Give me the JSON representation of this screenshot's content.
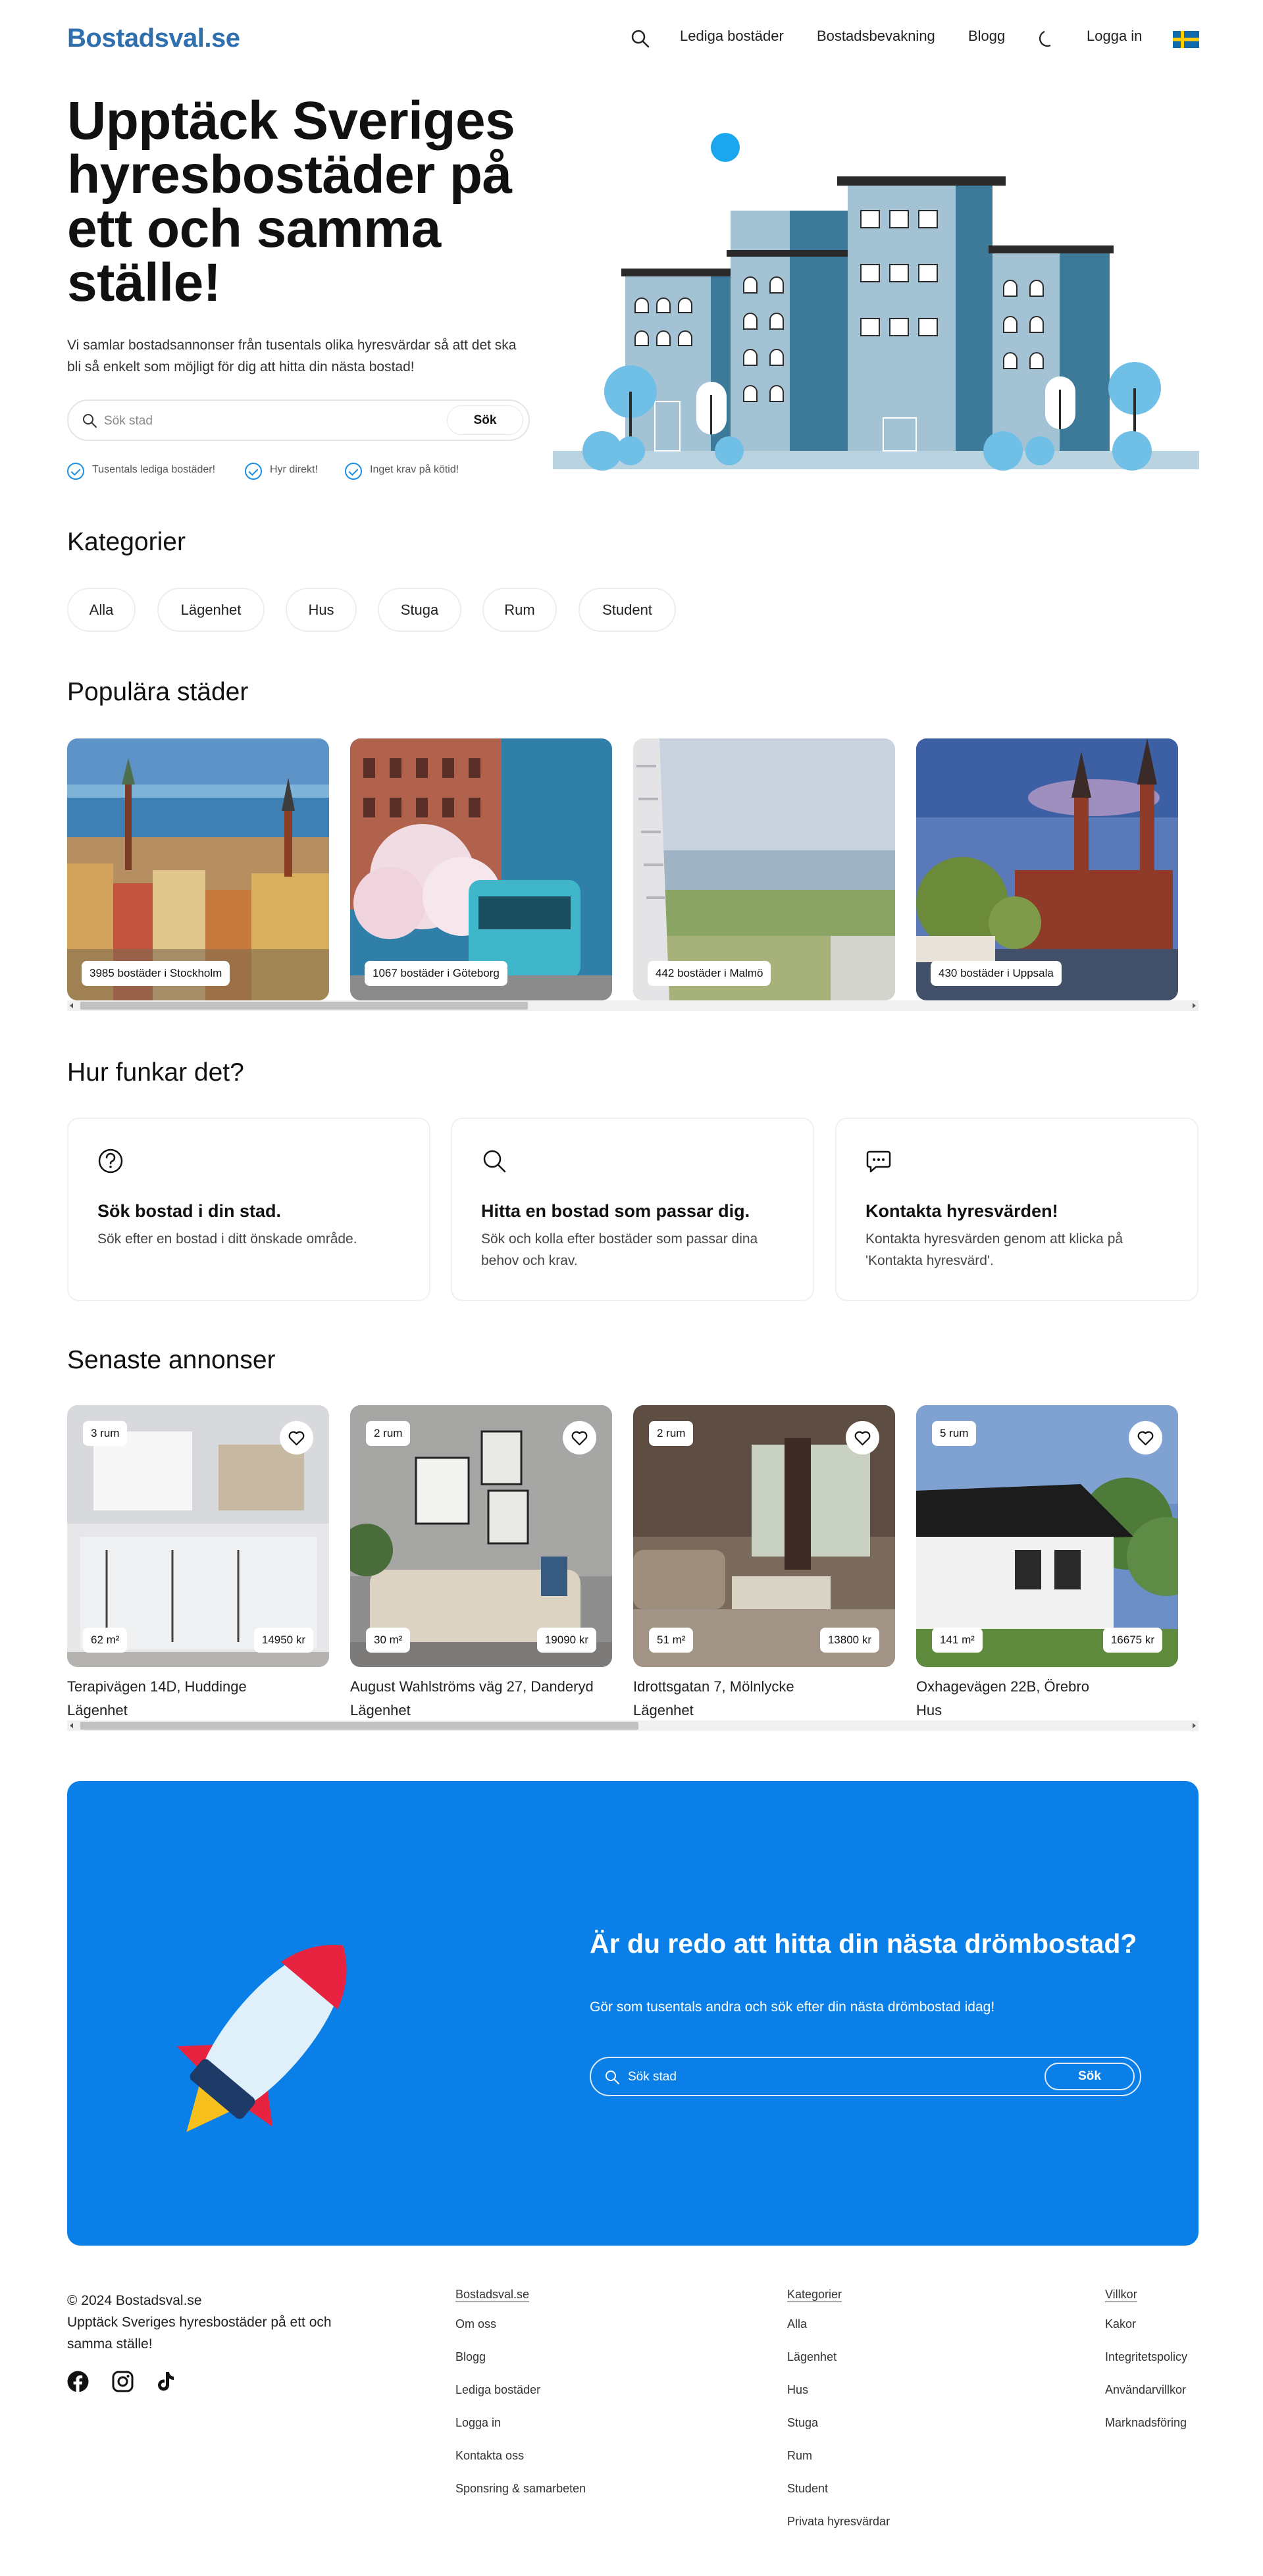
{
  "header": {
    "logo": "Bostadsval.se",
    "nav": [
      "Lediga bostäder",
      "Bostadsbevakning",
      "Blogg",
      "Logga in"
    ],
    "icons": [
      "search-icon",
      "moon-icon",
      "swedish-flag-icon"
    ]
  },
  "hero": {
    "title": "Upptäck Sveriges hyresbostäder på ett och samma ställe!",
    "subtitle": "Vi samlar bostadsannonser från tusentals olika hyresvärdar så att det ska bli så enkelt som möjligt för dig att hitta din nästa bostad!",
    "search_placeholder": "Sök stad",
    "search_button": "Sök",
    "features": [
      "Tusentals lediga bostäder!",
      "Hyr direkt!",
      "Inget krav på kötid!"
    ]
  },
  "categories": {
    "title": "Kategorier",
    "items": [
      "Alla",
      "Lägenhet",
      "Hus",
      "Stuga",
      "Rum",
      "Student"
    ]
  },
  "cities": {
    "title": "Populära städer",
    "items": [
      {
        "label": "3985 bostäder i Stockholm"
      },
      {
        "label": "1067 bostäder i Göteborg"
      },
      {
        "label": "442 bostäder i Malmö"
      },
      {
        "label": "430 bostäder i Uppsala"
      }
    ]
  },
  "how": {
    "title": "Hur funkar det?",
    "cards": [
      {
        "icon": "question-circle-icon",
        "title": "Sök bostad i din stad.",
        "desc": "Sök efter en bostad i ditt önskade område."
      },
      {
        "icon": "search-icon",
        "title": "Hitta en bostad som passar dig.",
        "desc": "Sök och kolla efter bostäder som passar dina behov och krav."
      },
      {
        "icon": "chat-icon",
        "title": "Kontakta hyresvärden!",
        "desc": "Kontakta hyresvärden genom att klicka på 'Kontakta hyresvärd'."
      }
    ]
  },
  "latest": {
    "title": "Senaste annonser",
    "items": [
      {
        "rooms": "3 rum",
        "size": "62 m²",
        "price": "14950 kr",
        "address": "Terapivägen 14D, Huddinge",
        "type": "Lägenhet"
      },
      {
        "rooms": "2 rum",
        "size": "30 m²",
        "price": "19090 kr",
        "address": "August Wahlströms väg 27, Danderyd",
        "type": "Lägenhet"
      },
      {
        "rooms": "2 rum",
        "size": "51 m²",
        "price": "13800 kr",
        "address": "Idrottsgatan 7, Mölnlycke",
        "type": "Lägenhet"
      },
      {
        "rooms": "5 rum",
        "size": "141 m²",
        "price": "16675 kr",
        "address": "Oxhagevägen 22B, Örebro",
        "type": "Hus"
      }
    ]
  },
  "cta": {
    "title": "Är du redo att hitta din nästa drömbostad?",
    "subtitle": "Gör som tusentals andra och sök efter din nästa drömbostad idag!",
    "search_placeholder": "Sök stad",
    "search_button": "Sök"
  },
  "footer": {
    "copyright": "© 2024 Bostadsval.se",
    "tagline": "Upptäck Sveriges hyresbostäder på ett och samma ställe!",
    "social_icons": [
      "facebook-icon",
      "instagram-icon",
      "tiktok-icon"
    ],
    "columns": [
      {
        "title": "Bostadsval.se",
        "items": [
          "Om oss",
          "Blogg",
          "Lediga bostäder",
          "Logga in",
          "Kontakta oss",
          "Sponsring & samarbeten"
        ]
      },
      {
        "title": "Kategorier",
        "items": [
          "Alla",
          "Lägenhet",
          "Hus",
          "Stuga",
          "Rum",
          "Student",
          "Privata hyresvärdar"
        ]
      },
      {
        "title": "Villkor",
        "items": [
          "Kakor",
          "Integritetspolicy",
          "Användarvillkor",
          "Marknadsföring"
        ]
      }
    ]
  },
  "colors": {
    "brand": "#2f6fae",
    "accent": "#0a7fe8",
    "check": "#1a8fe3"
  }
}
